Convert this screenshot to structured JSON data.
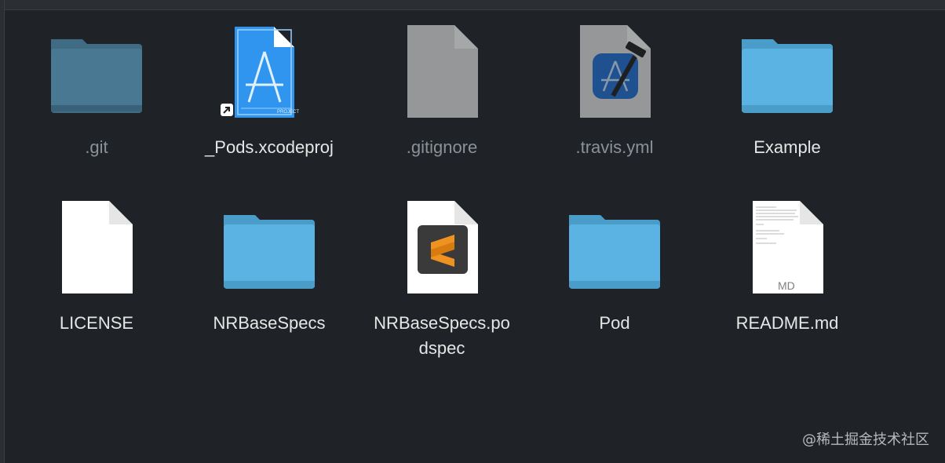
{
  "finder": {
    "items": [
      {
        "name": ".git",
        "kind": "folder",
        "hidden": true
      },
      {
        "name": "_Pods.xcodeproj",
        "kind": "xcodeproj-alias",
        "badge": "PROJECT"
      },
      {
        "name": ".gitignore",
        "kind": "generic-file",
        "hidden": true
      },
      {
        "name": ".travis.yml",
        "kind": "xcode-file",
        "hidden": true
      },
      {
        "name": "Example",
        "kind": "folder"
      },
      {
        "name": "LICENSE",
        "kind": "blank-file"
      },
      {
        "name": "NRBaseSpecs",
        "kind": "folder"
      },
      {
        "name": "NRBaseSpecs.po",
        "name_line2": "dspec",
        "kind": "sublime-file"
      },
      {
        "name": "Pod",
        "kind": "folder"
      },
      {
        "name": "README.md",
        "kind": "markdown-file",
        "badge": "MD"
      }
    ]
  },
  "watermark": "@稀土掘金技术社区",
  "colors": {
    "background": "#1f2327",
    "folder": "#5bb3e3",
    "xcode_blue": "#2f95ef",
    "sublime_orange": "#f0921f"
  }
}
